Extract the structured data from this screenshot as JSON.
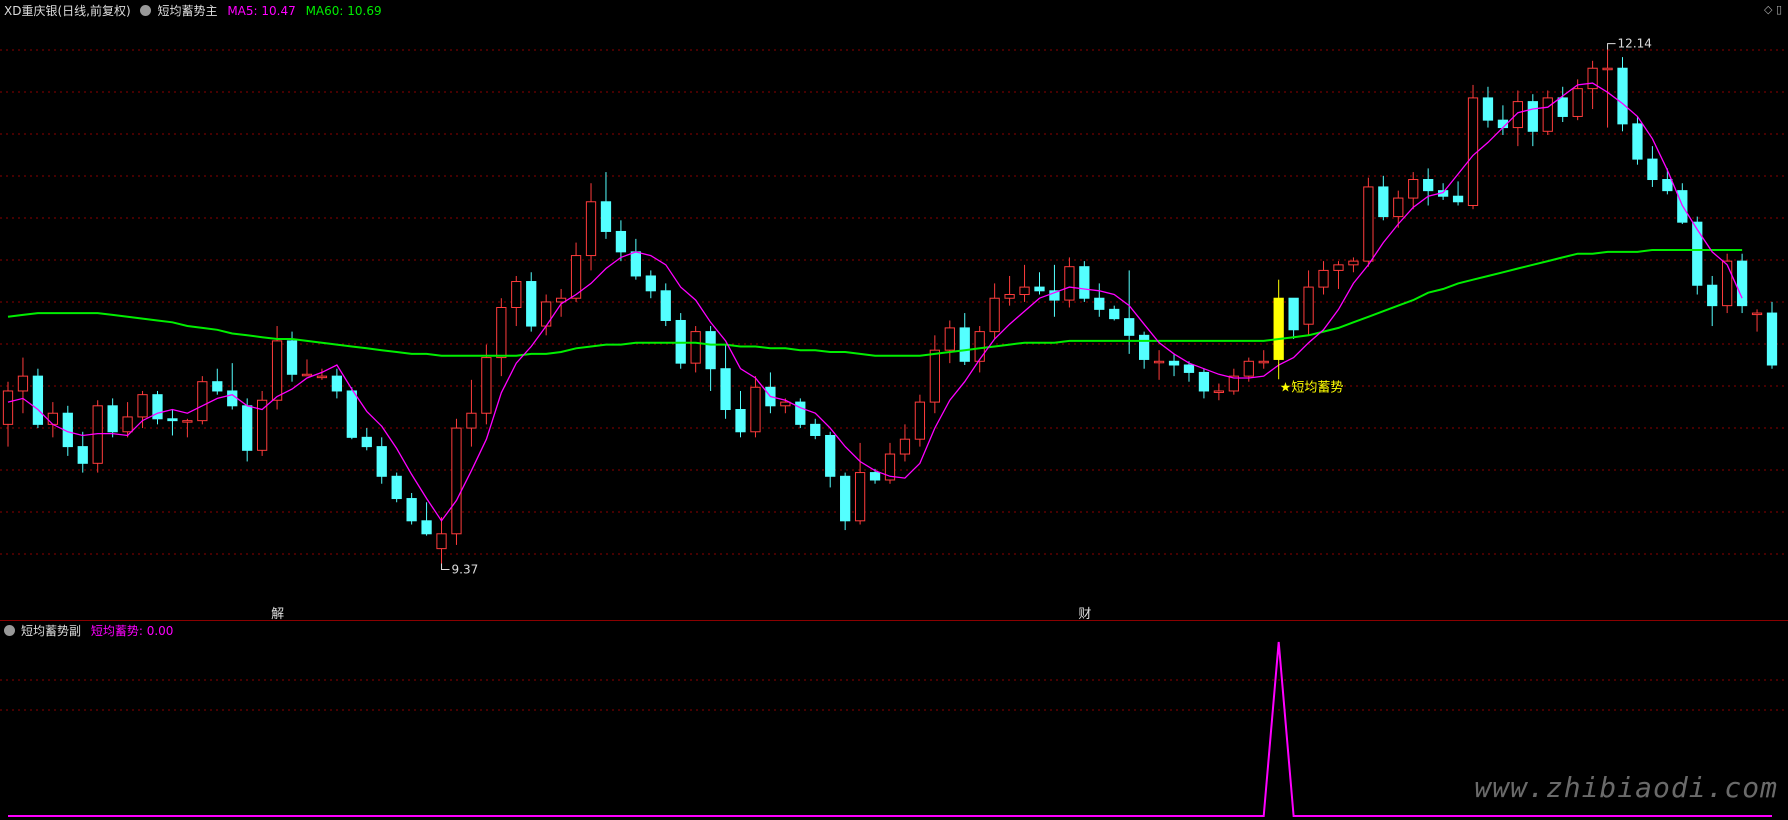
{
  "main_header": {
    "stock": "XD重庆银(日线,前复权)",
    "indicator": "短均蓄势主",
    "ma5_label": "MA5: 10.47",
    "ma60_label": "MA60: 10.69"
  },
  "sub_header": {
    "indicator": "短均蓄势副",
    "value_label": "短均蓄势: 0.00"
  },
  "top_right_icons": [
    "◇",
    "▯"
  ],
  "markers": {
    "high_label": "12.14",
    "low_label": "9.37",
    "signal_label": "★短均蓄势"
  },
  "events": [
    "解",
    "财"
  ],
  "watermark": "www.zhibiaodi.com",
  "colors": {
    "up": "#ff3c3c",
    "down": "#54ffff",
    "ma5": "#ff00ff",
    "ma60": "#00ee00",
    "signal": "#ffff00",
    "sub_line": "#ff00ff",
    "grid": "#8b0000"
  },
  "chart_data": {
    "type": "candlestick",
    "ylim": [
      9.2,
      12.3
    ],
    "ohlc": [
      [
        10.12,
        10.35,
        10.0,
        10.3
      ],
      [
        10.3,
        10.48,
        10.18,
        10.38
      ],
      [
        10.38,
        10.42,
        10.1,
        10.12
      ],
      [
        10.12,
        10.24,
        10.05,
        10.18
      ],
      [
        10.18,
        10.22,
        9.95,
        10.0
      ],
      [
        10.0,
        10.08,
        9.86,
        9.91
      ],
      [
        9.91,
        10.25,
        9.86,
        10.22
      ],
      [
        10.22,
        10.26,
        10.05,
        10.08
      ],
      [
        10.08,
        10.24,
        10.05,
        10.16
      ],
      [
        10.16,
        10.3,
        10.1,
        10.28
      ],
      [
        10.28,
        10.3,
        10.12,
        10.15
      ],
      [
        10.15,
        10.2,
        10.06,
        10.14
      ],
      [
        10.14,
        10.15,
        10.05,
        10.14
      ],
      [
        10.14,
        10.38,
        10.12,
        10.35
      ],
      [
        10.35,
        10.42,
        10.28,
        10.3
      ],
      [
        10.3,
        10.45,
        10.2,
        10.22
      ],
      [
        10.22,
        10.26,
        9.92,
        9.98
      ],
      [
        9.98,
        10.3,
        9.95,
        10.25
      ],
      [
        10.25,
        10.65,
        10.2,
        10.57
      ],
      [
        10.57,
        10.62,
        10.35,
        10.39
      ],
      [
        10.39,
        10.47,
        10.38,
        10.39
      ],
      [
        10.38,
        10.42,
        10.36,
        10.38
      ],
      [
        10.38,
        10.42,
        10.26,
        10.3
      ],
      [
        10.3,
        10.32,
        10.04,
        10.05
      ],
      [
        10.05,
        10.1,
        9.98,
        10.0
      ],
      [
        10.0,
        10.05,
        9.8,
        9.84
      ],
      [
        9.84,
        9.86,
        9.7,
        9.72
      ],
      [
        9.72,
        9.75,
        9.58,
        9.6
      ],
      [
        9.6,
        9.7,
        9.52,
        9.53
      ],
      [
        9.45,
        9.62,
        9.37,
        9.53
      ],
      [
        9.53,
        10.15,
        9.47,
        10.1
      ],
      [
        10.1,
        10.36,
        10.0,
        10.18
      ],
      [
        10.18,
        10.55,
        10.12,
        10.48
      ],
      [
        10.48,
        10.8,
        10.38,
        10.75
      ],
      [
        10.75,
        10.92,
        10.65,
        10.89
      ],
      [
        10.89,
        10.94,
        10.62,
        10.65
      ],
      [
        10.65,
        10.82,
        10.6,
        10.78
      ],
      [
        10.78,
        10.85,
        10.7,
        10.8
      ],
      [
        10.8,
        11.1,
        10.78,
        11.03
      ],
      [
        11.03,
        11.42,
        10.95,
        11.32
      ],
      [
        11.32,
        11.48,
        11.12,
        11.16
      ],
      [
        11.16,
        11.22,
        11.0,
        11.05
      ],
      [
        11.05,
        11.12,
        10.9,
        10.92
      ],
      [
        10.92,
        10.95,
        10.8,
        10.84
      ],
      [
        10.84,
        10.88,
        10.65,
        10.68
      ],
      [
        10.68,
        10.72,
        10.42,
        10.45
      ],
      [
        10.45,
        10.65,
        10.4,
        10.62
      ],
      [
        10.62,
        10.65,
        10.3,
        10.42
      ],
      [
        10.42,
        10.55,
        10.15,
        10.2
      ],
      [
        10.2,
        10.3,
        10.05,
        10.08
      ],
      [
        10.08,
        10.38,
        10.05,
        10.32
      ],
      [
        10.32,
        10.4,
        10.18,
        10.22
      ],
      [
        10.22,
        10.26,
        10.18,
        10.24
      ],
      [
        10.24,
        10.26,
        10.1,
        10.12
      ],
      [
        10.12,
        10.15,
        10.04,
        10.06
      ],
      [
        10.06,
        10.08,
        9.78,
        9.84
      ],
      [
        9.84,
        9.86,
        9.55,
        9.6
      ],
      [
        9.6,
        10.02,
        9.58,
        9.86
      ],
      [
        9.86,
        9.88,
        9.8,
        9.82
      ],
      [
        9.82,
        10.02,
        9.8,
        9.96
      ],
      [
        9.96,
        10.12,
        9.92,
        10.04
      ],
      [
        10.04,
        10.28,
        10.0,
        10.24
      ],
      [
        10.24,
        10.6,
        10.18,
        10.52
      ],
      [
        10.52,
        10.68,
        10.45,
        10.64
      ],
      [
        10.64,
        10.72,
        10.44,
        10.46
      ],
      [
        10.46,
        10.65,
        10.4,
        10.62
      ],
      [
        10.62,
        10.88,
        10.58,
        10.8
      ],
      [
        10.8,
        10.92,
        10.76,
        10.82
      ],
      [
        10.82,
        10.98,
        10.78,
        10.86
      ],
      [
        10.86,
        10.94,
        10.82,
        10.84
      ],
      [
        10.84,
        10.98,
        10.7,
        10.79
      ],
      [
        10.79,
        11.02,
        10.75,
        10.97
      ],
      [
        10.97,
        11.0,
        10.78,
        10.8
      ],
      [
        10.8,
        10.88,
        10.7,
        10.74
      ],
      [
        10.74,
        10.76,
        10.68,
        10.69
      ],
      [
        10.69,
        10.95,
        10.5,
        10.6
      ],
      [
        10.6,
        10.62,
        10.42,
        10.47
      ],
      [
        10.46,
        10.52,
        10.36,
        10.46
      ],
      [
        10.46,
        10.5,
        10.38,
        10.44
      ],
      [
        10.44,
        10.46,
        10.35,
        10.4
      ],
      [
        10.4,
        10.42,
        10.26,
        10.3
      ],
      [
        10.3,
        10.34,
        10.25,
        10.3
      ],
      [
        10.3,
        10.42,
        10.28,
        10.38
      ],
      [
        10.38,
        10.48,
        10.35,
        10.46
      ],
      [
        10.46,
        10.52,
        10.42,
        10.46
      ],
      [
        10.47,
        10.9,
        10.46,
        10.8
      ],
      [
        10.8,
        10.8,
        10.58,
        10.63
      ],
      [
        10.66,
        10.95,
        10.6,
        10.86
      ],
      [
        10.86,
        11.0,
        10.82,
        10.95
      ],
      [
        10.95,
        11.0,
        10.85,
        10.98
      ],
      [
        10.98,
        11.02,
        10.94,
        11.0
      ],
      [
        11.0,
        11.45,
        10.97,
        11.4
      ],
      [
        11.4,
        11.46,
        11.22,
        11.24
      ],
      [
        11.24,
        11.38,
        11.18,
        11.34
      ],
      [
        11.34,
        11.48,
        11.28,
        11.44
      ],
      [
        11.44,
        11.5,
        11.3,
        11.38
      ],
      [
        11.38,
        11.42,
        11.33,
        11.35
      ],
      [
        11.35,
        11.43,
        11.3,
        11.32
      ],
      [
        11.3,
        11.95,
        11.28,
        11.88
      ],
      [
        11.88,
        11.94,
        11.72,
        11.76
      ],
      [
        11.76,
        11.84,
        11.68,
        11.72
      ],
      [
        11.72,
        11.92,
        11.62,
        11.86
      ],
      [
        11.86,
        11.9,
        11.62,
        11.7
      ],
      [
        11.7,
        11.92,
        11.68,
        11.88
      ],
      [
        11.88,
        11.94,
        11.75,
        11.78
      ],
      [
        11.78,
        11.98,
        11.76,
        11.93
      ],
      [
        11.93,
        12.08,
        11.82,
        12.04
      ],
      [
        12.04,
        12.14,
        11.72,
        12.04
      ],
      [
        12.04,
        12.1,
        11.7,
        11.74
      ],
      [
        11.74,
        11.78,
        11.52,
        11.55
      ],
      [
        11.55,
        11.62,
        11.4,
        11.44
      ],
      [
        11.44,
        11.5,
        11.36,
        11.38
      ],
      [
        11.38,
        11.42,
        11.2,
        11.21
      ],
      [
        11.21,
        11.24,
        10.82,
        10.87
      ],
      [
        10.87,
        10.92,
        10.65,
        10.76
      ],
      [
        10.76,
        11.04,
        10.72,
        11.0
      ],
      [
        11.0,
        11.04,
        10.72,
        10.76
      ],
      [
        10.72,
        10.74,
        10.62,
        10.72
      ],
      [
        10.72,
        10.78,
        10.42,
        10.44
      ]
    ],
    "ma5": [
      10.24,
      10.26,
      10.2,
      10.12,
      10.08,
      10.06,
      10.07,
      10.07,
      10.06,
      10.14,
      10.18,
      10.2,
      10.18,
      10.22,
      10.26,
      10.28,
      10.22,
      10.2,
      10.27,
      10.31,
      10.37,
      10.4,
      10.44,
      10.31,
      10.19,
      10.11,
      9.99,
      9.85,
      9.72,
      9.6,
      9.71,
      9.87,
      10.04,
      10.29,
      10.45,
      10.54,
      10.65,
      10.77,
      10.82,
      10.88,
      10.96,
      11.02,
      11.05,
      11.03,
      10.98,
      10.86,
      10.79,
      10.67,
      10.57,
      10.42,
      10.37,
      10.27,
      10.25,
      10.21,
      10.18,
      10.1,
      10.0,
      9.92,
      9.87,
      9.84,
      9.83,
      9.91,
      10.1,
      10.25,
      10.35,
      10.47,
      10.58,
      10.66,
      10.73,
      10.8,
      10.83,
      10.86,
      10.85,
      10.84,
      10.82,
      10.76,
      10.66,
      10.56,
      10.5,
      10.45,
      10.42,
      10.39,
      10.37,
      10.37,
      10.38,
      10.44,
      10.48,
      10.56,
      10.63,
      10.74,
      10.88,
      10.98,
      11.1,
      11.2,
      11.29,
      11.35,
      11.37,
      11.47,
      11.57,
      11.64,
      11.72,
      11.8,
      11.82,
      11.83,
      11.89,
      11.95,
      11.96,
      11.91,
      11.85,
      11.78,
      11.66,
      11.49,
      11.3,
      11.17,
      11.05,
      10.98,
      10.8
    ],
    "ma60": [
      10.7,
      10.71,
      10.72,
      10.72,
      10.72,
      10.72,
      10.72,
      10.71,
      10.7,
      10.69,
      10.68,
      10.67,
      10.65,
      10.64,
      10.63,
      10.61,
      10.6,
      10.59,
      10.58,
      10.58,
      10.57,
      10.56,
      10.55,
      10.54,
      10.53,
      10.52,
      10.51,
      10.5,
      10.5,
      10.49,
      10.49,
      10.49,
      10.49,
      10.49,
      10.49,
      10.5,
      10.5,
      10.51,
      10.53,
      10.54,
      10.55,
      10.55,
      10.56,
      10.56,
      10.56,
      10.56,
      10.56,
      10.55,
      10.55,
      10.54,
      10.54,
      10.53,
      10.53,
      10.52,
      10.52,
      10.51,
      10.51,
      10.5,
      10.49,
      10.49,
      10.49,
      10.49,
      10.5,
      10.51,
      10.52,
      10.53,
      10.54,
      10.55,
      10.56,
      10.56,
      10.56,
      10.57,
      10.57,
      10.57,
      10.57,
      10.57,
      10.57,
      10.57,
      10.57,
      10.57,
      10.57,
      10.57,
      10.57,
      10.57,
      10.57,
      10.58,
      10.59,
      10.6,
      10.62,
      10.64,
      10.67,
      10.7,
      10.73,
      10.76,
      10.79,
      10.83,
      10.85,
      10.88,
      10.9,
      10.92,
      10.94,
      10.96,
      10.98,
      11.0,
      11.02,
      11.04,
      11.04,
      11.05,
      11.05,
      11.05,
      11.06,
      11.06,
      11.06,
      11.06,
      11.06,
      11.06,
      11.06
    ],
    "signal_index": 85,
    "high_index": 107,
    "low_index": 29,
    "event_indices": [
      18,
      72
    ],
    "sub_series": {
      "name": "短均蓄势",
      "ylim": [
        0,
        1
      ],
      "values_zero_except": {
        "index": 85,
        "value": 1
      }
    }
  }
}
